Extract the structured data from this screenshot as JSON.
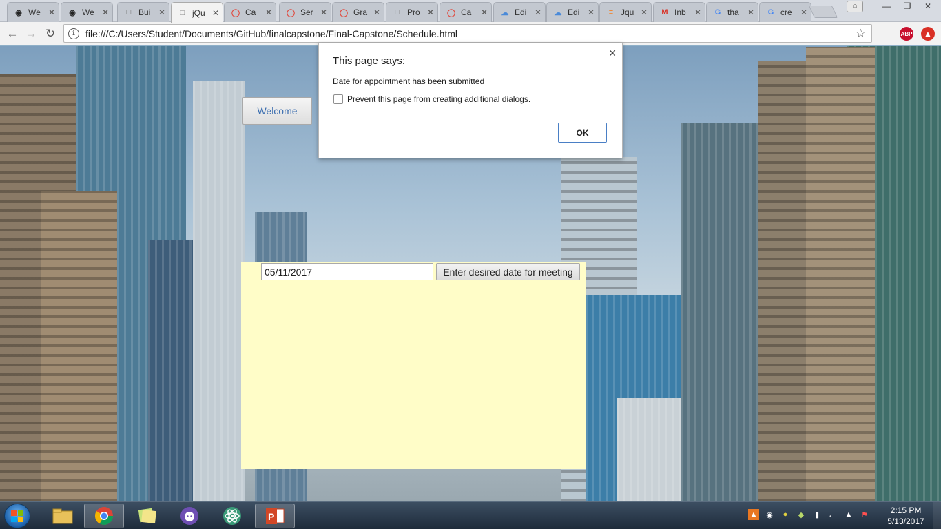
{
  "browser": {
    "tabs": [
      {
        "label": "We",
        "icon": "github-icon"
      },
      {
        "label": "We",
        "icon": "github-icon"
      },
      {
        "label": "Bui",
        "icon": "page-icon"
      },
      {
        "label": "jQu",
        "icon": "page-icon"
      },
      {
        "label": "Ca",
        "icon": "codepen-icon"
      },
      {
        "label": "Ser",
        "icon": "codepen-icon"
      },
      {
        "label": "Gra",
        "icon": "codepen-icon"
      },
      {
        "label": "Pro",
        "icon": "page-icon"
      },
      {
        "label": "Ca",
        "icon": "codepen-icon"
      },
      {
        "label": "Edi",
        "icon": "cloud-icon"
      },
      {
        "label": "Edi",
        "icon": "cloud-icon"
      },
      {
        "label": "Jqu",
        "icon": "stackoverflow-icon"
      },
      {
        "label": "Inb",
        "icon": "gmail-icon"
      },
      {
        "label": "tha",
        "icon": "google-icon"
      },
      {
        "label": "cre",
        "icon": "google-icon"
      }
    ],
    "url": "file:///C:/Users/Student/Documents/GitHub/finalcapstone/Final-Capstone/Schedule.html",
    "extensions": {
      "abp": "ABP"
    }
  },
  "page": {
    "welcome_label": "Welcome",
    "date_value": "05/11/2017",
    "date_button_label": "Enter desired date for meeting",
    "panel_color": "#fffdc8"
  },
  "dialog": {
    "title": "This page says:",
    "message": "Date for appointment has been submitted",
    "checkbox_label": "Prevent this page from creating additional dialogs.",
    "ok_label": "OK"
  },
  "taskbar": {
    "time": "2:15 PM",
    "date": "5/13/2017"
  }
}
